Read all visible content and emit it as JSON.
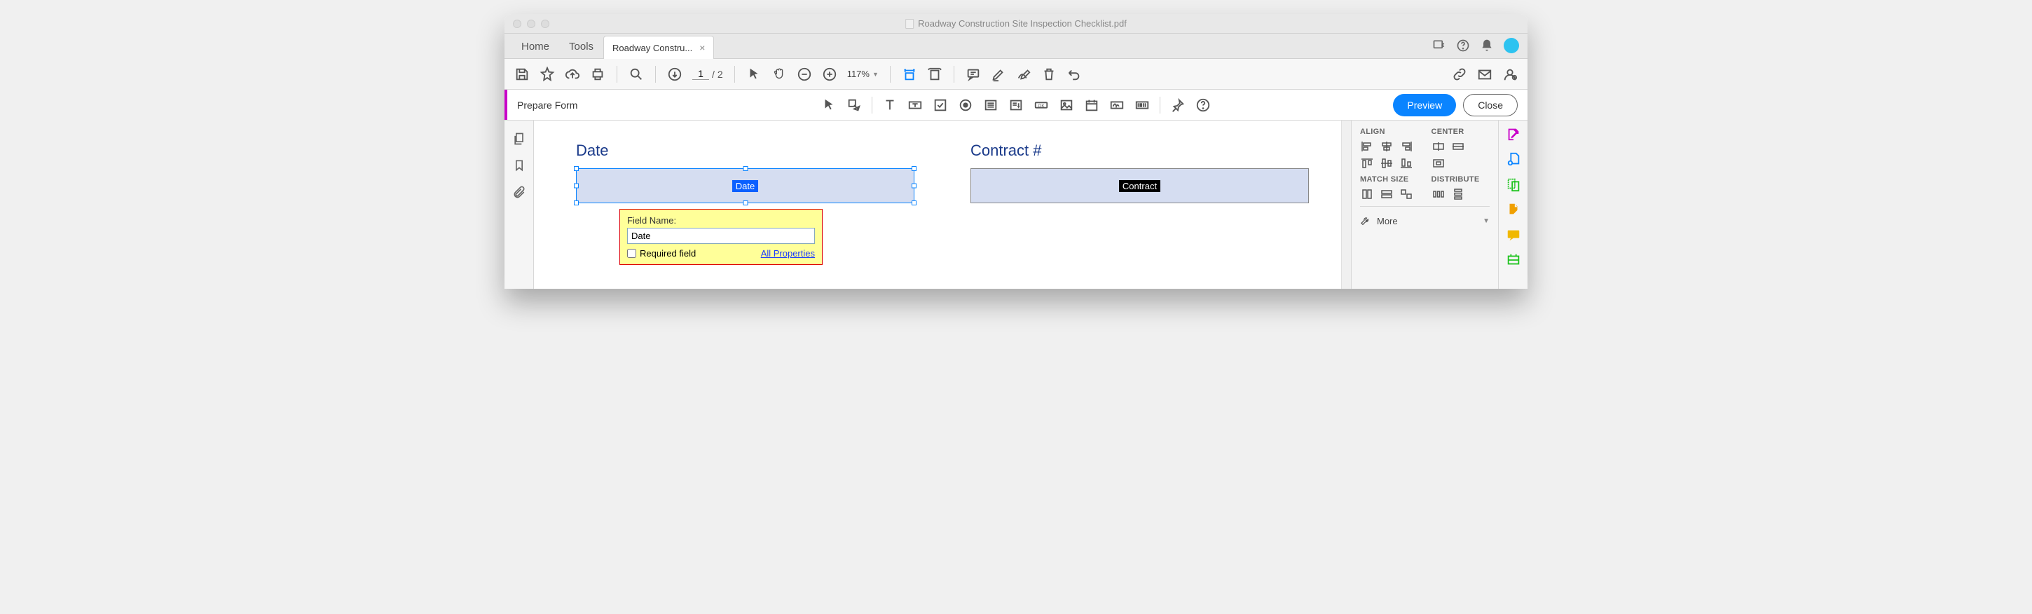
{
  "window_title": "Roadway Construction Site Inspection Checklist.pdf",
  "menu": {
    "home": "Home",
    "tools": "Tools"
  },
  "doc_tab": "Roadway Constru...",
  "toolbar": {
    "page_current": "1",
    "page_sep": "/",
    "page_total": "2",
    "zoom": "117%"
  },
  "prepbar": {
    "label": "Prepare Form",
    "preview": "Preview",
    "close": "Close"
  },
  "document": {
    "date_label": "Date",
    "date_field_tag": "Date",
    "contract_label": "Contract #",
    "contract_field_tag": "Contract"
  },
  "popup": {
    "field_name_label": "Field Name:",
    "field_name_value": "Date",
    "required": "Required field",
    "all_properties": "All Properties"
  },
  "rightpanel": {
    "align": "ALIGN",
    "center": "CENTER",
    "match_size": "MATCH SIZE",
    "distribute": "DISTRIBUTE",
    "more": "More"
  }
}
